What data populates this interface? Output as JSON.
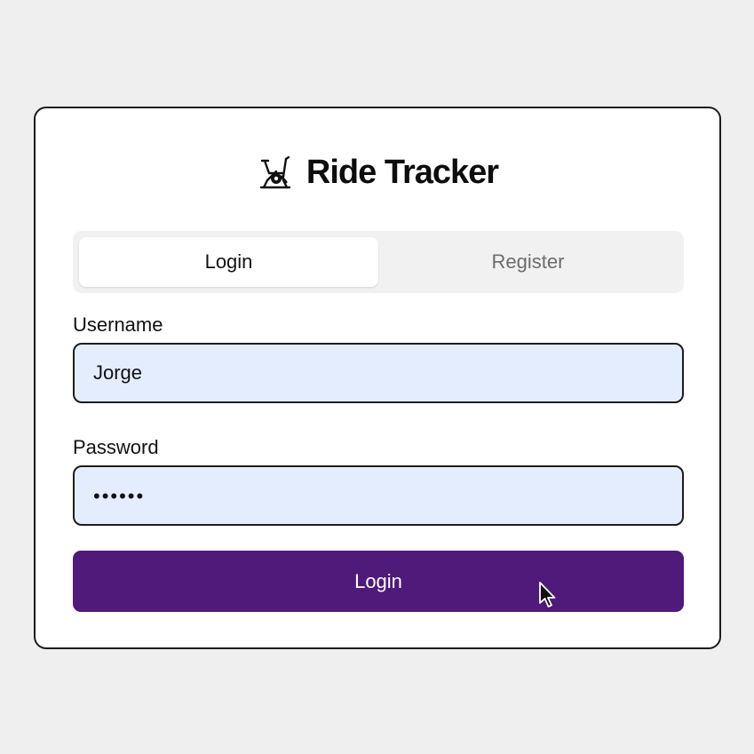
{
  "brand": {
    "icon": "exercise-bike-icon",
    "title": "Ride Tracker"
  },
  "tabs": [
    {
      "label": "Login",
      "active": true
    },
    {
      "label": "Register",
      "active": false
    }
  ],
  "form": {
    "username_label": "Username",
    "username_value": "Jorge",
    "password_label": "Password",
    "password_value": "••••••",
    "submit_label": "Login"
  },
  "colors": {
    "accent": "#4f1a7a",
    "input_bg": "#e4edfd",
    "page_bg": "#efefef"
  }
}
